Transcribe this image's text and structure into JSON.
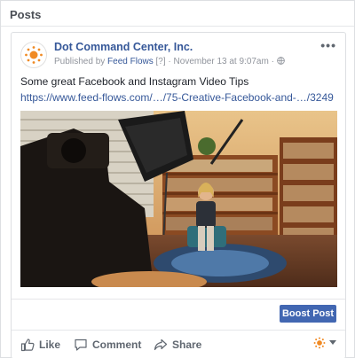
{
  "section": {
    "title": "Posts"
  },
  "post": {
    "page_name": "Dot Command Center, Inc.",
    "meta_prefix": "Published by",
    "publisher": "Feed Flows",
    "publisher_badge": "[?]",
    "separator": "·",
    "timestamp": "November 13 at 9:07am",
    "audience_icon": "globe-icon",
    "text": "Some great Facebook and Instagram Video Tips",
    "link": "https://www.feed-flows.com/…/75-Creative-Facebook-and-…/3249",
    "more_label": "•••",
    "image_description": "video-production-photo"
  },
  "actions": {
    "boost_label": "Boost Post",
    "like_label": "Like",
    "comment_label": "Comment",
    "share_label": "Share"
  },
  "colors": {
    "link": "#365899",
    "brand_blue": "#4267b2",
    "meta_gray": "#90949c",
    "avatar_orange": "#f08a24"
  }
}
